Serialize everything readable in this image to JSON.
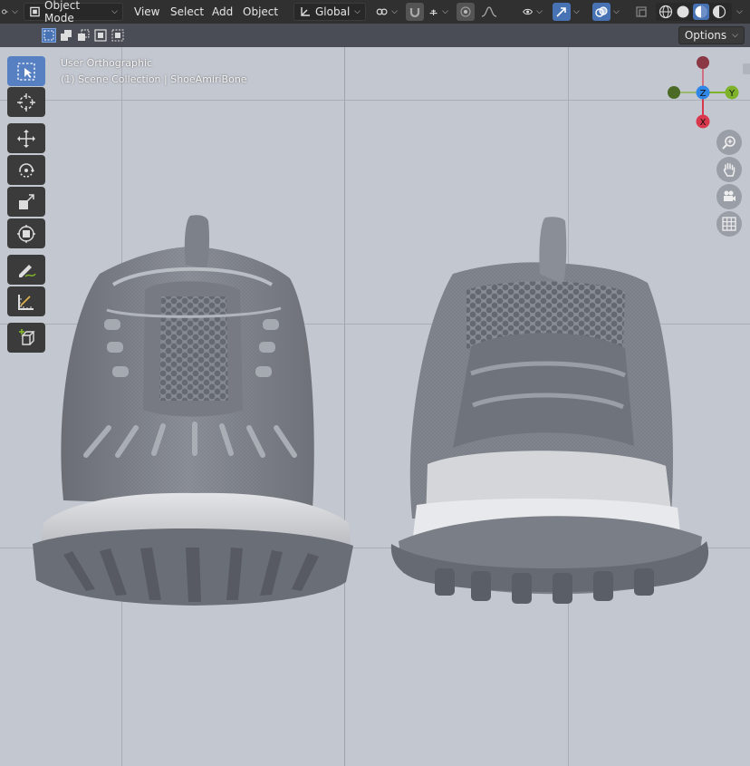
{
  "header": {
    "mode_selector": "Object Mode",
    "menus": [
      "View",
      "Select",
      "Add",
      "Object"
    ],
    "transform_orientation": "Global"
  },
  "toolsettings": {
    "options_label": "Options"
  },
  "viewport": {
    "view_name": "User Orthographic",
    "collection_info": "(1) Scene Collection | ShoeAmiriBone",
    "gizmo": {
      "z": "Z",
      "y": "Y",
      "x": "X"
    }
  },
  "colors": {
    "accent": "#4772b3",
    "viewport_bg": "#c3c7d0",
    "axis_x": "#d9384c",
    "axis_y": "#7eb22a",
    "axis_z": "#2f86e6"
  }
}
